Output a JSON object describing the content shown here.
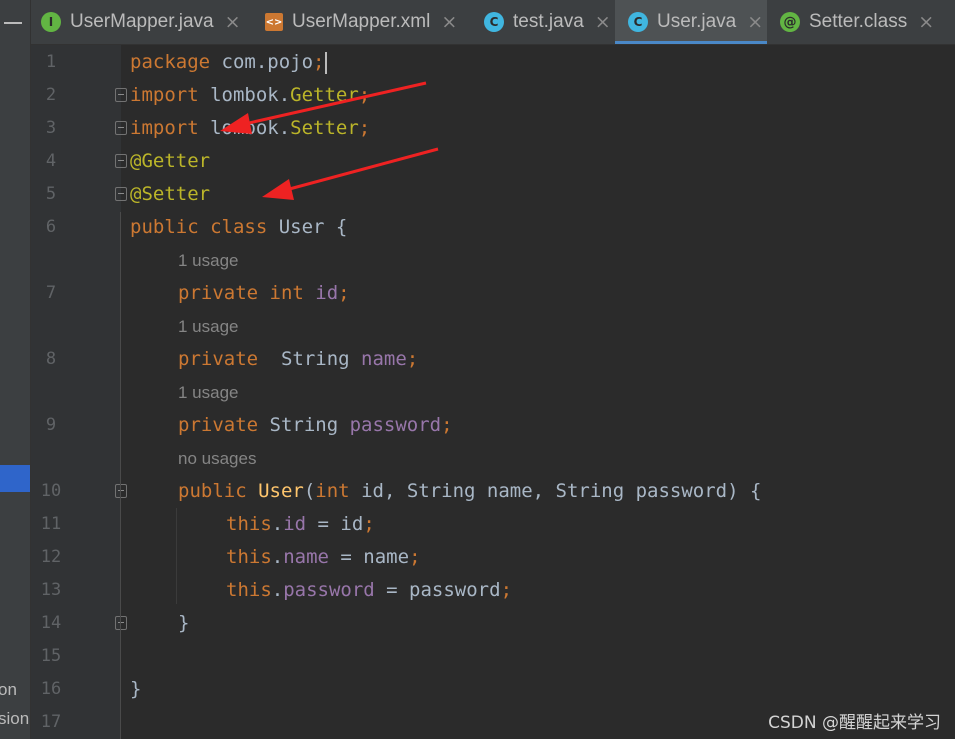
{
  "left_strip": {
    "fragment_a": "on",
    "fragment_b": "sion"
  },
  "tabs": [
    {
      "label": "UserMapper.java",
      "icon": "interface-icon",
      "icon_char": "I"
    },
    {
      "label": "UserMapper.xml",
      "icon": "xml-file-icon",
      "icon_char": "<>"
    },
    {
      "label": "test.java",
      "icon": "class-icon",
      "icon_char": "C"
    },
    {
      "label": "User.java",
      "icon": "class-icon",
      "icon_char": "C"
    },
    {
      "label": "Setter.class",
      "icon": "annotation-icon",
      "icon_char": "@"
    }
  ],
  "active_tab": "User.java",
  "close_glyph": "×",
  "line_numbers": [
    "1",
    "2",
    "3",
    "4",
    "5",
    "6",
    "7",
    "8",
    "9",
    "10",
    "11",
    "12",
    "13",
    "14",
    "15",
    "16",
    "17"
  ],
  "code": {
    "l1_kw": "package",
    "l1_rest": " com.pojo",
    "l1_semi": ";",
    "l2_kw": "import",
    "l2_pkg": " lombok.",
    "l2_cls": "Getter",
    "l2_semi": ";",
    "l3_kw": "import",
    "l3_pkg": " lombok.",
    "l3_cls": "Setter",
    "l3_semi": ";",
    "l4_ann": "@Getter",
    "l5_ann": "@Setter",
    "l6_kw": "public class",
    "l6_rest": " User {",
    "hint7": "1 usage",
    "l7_kw": "private int",
    "l7_fld": " id",
    "l7_semi": ";",
    "hint8": "1 usage",
    "l8_kw": "private",
    "l8_type": "  String",
    "l8_fld": " name",
    "l8_semi": ";",
    "hint9": "1 usage",
    "l9_kw": "private",
    "l9_type": " String",
    "l9_fld": " password",
    "l9_semi": ";",
    "hint10": "no usages",
    "l10_kw": "public",
    "l10_fn": " User",
    "l10_open": "(",
    "l10_int": "int",
    "l10_p1": " id, String name, String password) {",
    "l11_this": "this",
    "l11_dot": ".",
    "l11_fld": "id",
    "l11_rest": " = id",
    "l11_semi": ";",
    "l12_this": "this",
    "l12_dot": ".",
    "l12_fld": "name",
    "l12_rest": " = name",
    "l12_semi": ";",
    "l13_this": "this",
    "l13_dot": ".",
    "l13_fld": "password",
    "l13_rest": " = password",
    "l13_semi": ";",
    "l14": "}",
    "l16": "}"
  },
  "watermark": "CSDN @醒醒起来学习",
  "colors": {
    "background": "#2b2b2b",
    "keyword": "#cc7832",
    "annotation": "#bbb529",
    "field": "#9876aa",
    "function": "#ffc66d",
    "text": "#a9b7c6",
    "arrow": "#ee2222"
  }
}
